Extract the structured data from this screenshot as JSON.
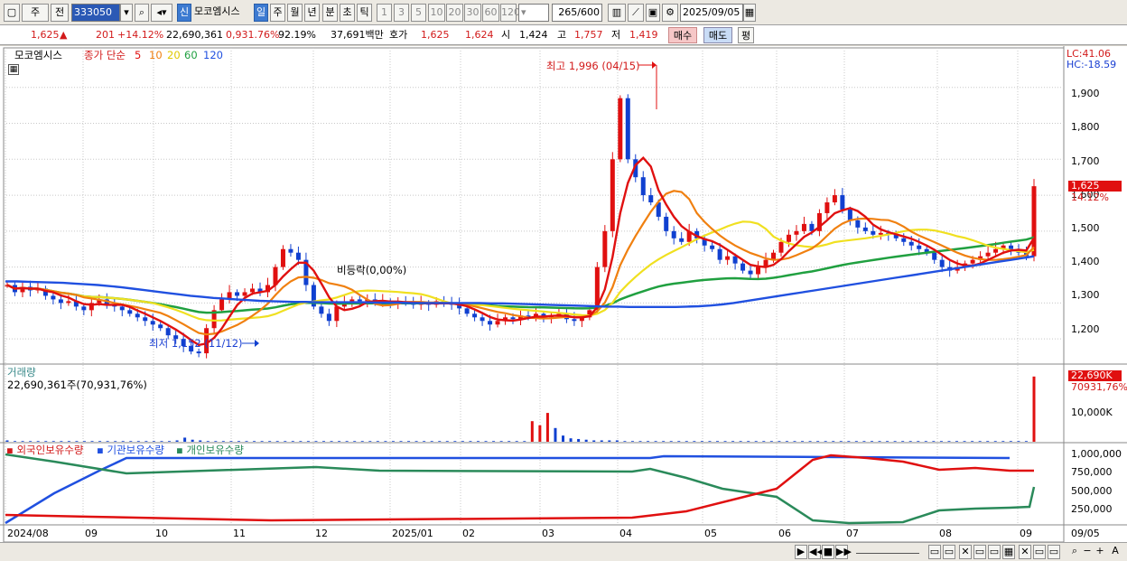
{
  "toolbar": {
    "market": "주",
    "prev": "전",
    "code": "333050",
    "name_badge": "신",
    "name": "모코엠시스",
    "periods": [
      "일",
      "주",
      "월",
      "년",
      "분",
      "초",
      "틱"
    ],
    "intervals": [
      "1",
      "3",
      "5",
      "10",
      "20",
      "30",
      "60",
      "120"
    ],
    "count": "265",
    "count_max": "/600",
    "date": "2025/09/05"
  },
  "quote": {
    "price": "1,625",
    "arrow": "▲",
    "change": "201",
    "change_pct": "+14.12%",
    "volume": "22,690,361",
    "vol_ratio": "0,931.76%",
    "turnover": "92.19%",
    "amount": "37,691백만",
    "ask_label": "호가",
    "ask": "1,625",
    "bid": "1,624",
    "open_label": "시",
    "open": "1,424",
    "high_label": "고",
    "high": "1,757",
    "low_label": "저",
    "low": "1,419",
    "buy": "매수",
    "sell": "매도",
    "eval": "평"
  },
  "legend": {
    "stock": "모코엠시스",
    "ma_label": "종가 단순",
    "ma": [
      "5",
      "10",
      "20",
      "60",
      "120"
    ],
    "volume": "거래량",
    "volume_value": "22,690,361주(70,931,76%)",
    "holdings": [
      "외국인보유수량",
      "기관보유수량",
      "개인보유수량"
    ]
  },
  "annotations": {
    "high": "최고 1,996 (04/15)",
    "low": "최저 1,152 (11/12)",
    "ex_rights": "비등락(0,00%)",
    "lc": "LC:41.06",
    "hc": "HC:-18.59",
    "price_box": "1,625",
    "price_pct": "14.12%",
    "vol_box": "22,690K",
    "vol_pct": "70931,76%"
  },
  "axes": {
    "price_ticks": [
      "1,900",
      "1,800",
      "1,700",
      "1,600",
      "1,500",
      "1,400",
      "1,300",
      "1,200"
    ],
    "vol_ticks": [
      "10,000K"
    ],
    "hold_ticks": [
      "1,000,000",
      "750,000",
      "500,000",
      "250,000"
    ],
    "months": [
      "2024/08",
      "09",
      "10",
      "11",
      "12",
      "2025/01",
      "02",
      "03",
      "04",
      "05",
      "06",
      "07",
      "08",
      "09"
    ],
    "last_date": "09/05"
  },
  "chart_data": {
    "type": "line",
    "price_range": [
      1130,
      2010
    ],
    "series_colors": {
      "ma5": "#e01010",
      "ma10": "#f08010",
      "ma20": "#f0e020",
      "ma60": "#20a040",
      "ma120": "#2050e0"
    },
    "close": [
      1350,
      1330,
      1345,
      1335,
      1340,
      1320,
      1310,
      1300,
      1305,
      1290,
      1280,
      1300,
      1310,
      1295,
      1290,
      1280,
      1270,
      1260,
      1250,
      1240,
      1230,
      1210,
      1200,
      1180,
      1165,
      1160,
      1230,
      1280,
      1310,
      1330,
      1320,
      1330,
      1340,
      1330,
      1350,
      1400,
      1450,
      1440,
      1420,
      1350,
      1290,
      1270,
      1250,
      1290,
      1300,
      1310,
      1305,
      1310,
      1300,
      1305,
      1300,
      1305,
      1300,
      1295,
      1300,
      1295,
      1305,
      1300,
      1295,
      1285,
      1270,
      1260,
      1250,
      1240,
      1250,
      1260,
      1255,
      1265,
      1260,
      1270,
      1260,
      1265,
      1270,
      1255,
      1250,
      1260,
      1280,
      1400,
      1500,
      1700,
      1870,
      1700,
      1650,
      1600,
      1580,
      1540,
      1500,
      1480,
      1470,
      1500,
      1480,
      1460,
      1450,
      1420,
      1430,
      1410,
      1390,
      1380,
      1400,
      1420,
      1440,
      1470,
      1490,
      1500,
      1520,
      1500,
      1550,
      1580,
      1600,
      1560,
      1530,
      1510,
      1500,
      1490,
      1495,
      1490,
      1480,
      1470,
      1460,
      1450,
      1440,
      1420,
      1400,
      1390,
      1400,
      1410,
      1420,
      1430,
      1440,
      1450,
      1460,
      1450,
      1440,
      1430,
      1625
    ],
    "ma120": [
      1360,
      1360,
      1359,
      1358,
      1357,
      1356,
      1354,
      1352,
      1350,
      1347,
      1344,
      1340,
      1336,
      1332,
      1328,
      1324,
      1320,
      1317,
      1314,
      1312,
      1310,
      1308,
      1306,
      1305,
      1304,
      1303,
      1303,
      1302,
      1302,
      1302,
      1302,
      1302,
      1301,
      1301,
      1301,
      1300,
      1300,
      1300,
      1300,
      1300,
      1300,
      1300,
      1299,
      1299,
      1298,
      1297,
      1296,
      1295,
      1294,
      1293,
      1292,
      1291,
      1290,
      1290,
      1289,
      1289,
      1289,
      1289,
      1289,
      1290,
      1291,
      1293,
      1296,
      1300,
      1305,
      1310,
      1315,
      1320,
      1325,
      1330,
      1335,
      1340,
      1345,
      1350,
      1355,
      1360,
      1365,
      1370,
      1375,
      1380,
      1385,
      1390,
      1395,
      1400,
      1405,
      1410,
      1415,
      1420,
      1425,
      1430
    ],
    "volume_bars": [
      2,
      1,
      1,
      1,
      1,
      1,
      1,
      1,
      1,
      1,
      1,
      1,
      1,
      1,
      1,
      1,
      1,
      1,
      1,
      1,
      1,
      1,
      2,
      6,
      3,
      2,
      1,
      1,
      1,
      1,
      1,
      1,
      1,
      1,
      1,
      1,
      1,
      1,
      1,
      1,
      1,
      1,
      1,
      1,
      1,
      1,
      1,
      1,
      1,
      1,
      1,
      1,
      1,
      1,
      1,
      1,
      1,
      1,
      1,
      1,
      1,
      1,
      1,
      1,
      1,
      1,
      1,
      1,
      30,
      24,
      42,
      20,
      9,
      5,
      4,
      3,
      2,
      2,
      2,
      2,
      1,
      1,
      1,
      1,
      1,
      1,
      1,
      1,
      1,
      1,
      1,
      1,
      1,
      1,
      1,
      1,
      1,
      1,
      1,
      1,
      1,
      1,
      1,
      1,
      1,
      1,
      1,
      1,
      1,
      1,
      1,
      1,
      1,
      1,
      1,
      1,
      1,
      1,
      1,
      1,
      1,
      1,
      1,
      1,
      1,
      1,
      1,
      1,
      1,
      1,
      1,
      1,
      1,
      95
    ]
  }
}
